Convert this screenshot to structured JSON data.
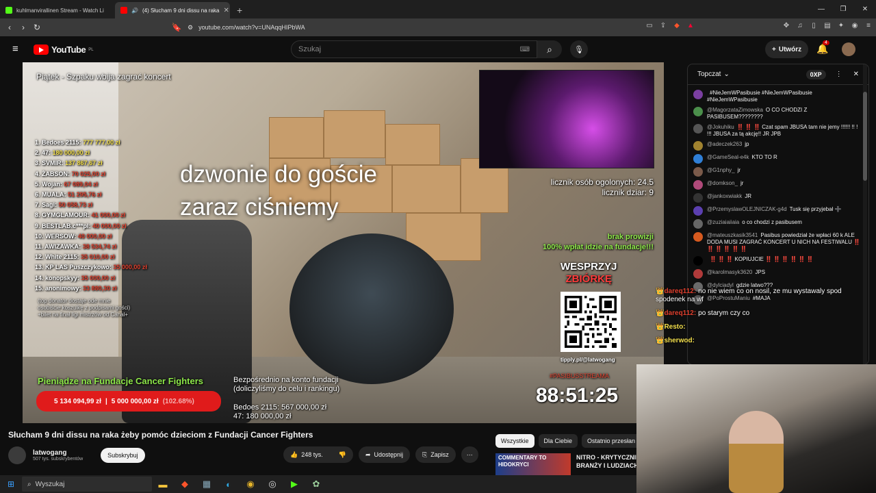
{
  "browser": {
    "tabs": [
      {
        "title": "kuhlmanvirallinen Stream - Watch Li",
        "color": "#53fc18"
      },
      {
        "title": "(4) Słucham 9 dni dissu na raka",
        "color": "#ff0000"
      }
    ],
    "url": "youtube.com/watch?v=UNAqqHIPbWA"
  },
  "yt": {
    "logo_text": "YouTube",
    "logo_country": "PL",
    "search_placeholder": "Szukaj",
    "create_label": "Utwórz",
    "notif_count": "4"
  },
  "stream": {
    "overlay_title": "Piątek - Szpaku wbija zagrać koncert",
    "big_text_line1": "dzwonie do goście",
    "big_text_line2": "zaraz ciśniemy",
    "leaderboard": [
      {
        "name": "1. Bedoes 2115:",
        "amount": "777 777,00 zł"
      },
      {
        "name": "2. 47:",
        "amount": "180 000,00 zł"
      },
      {
        "name": "3. SVMIR:",
        "amount": "137 867,67 zł"
      },
      {
        "name": "4. ŻABSON:",
        "amount": "70 025,00 zł"
      },
      {
        "name": "5. Wojan:",
        "amount": "67 089,04 zł"
      },
      {
        "name": "6. MUALA:",
        "amount": "51 295,76 zł"
      },
      {
        "name": "7. Sagi:",
        "amount": "50 058,73 zł"
      },
      {
        "name": "8. GYMGLAMOUR:",
        "amount": "41 000,00 zł"
      },
      {
        "name": "9. BESTLAB.c***pl:",
        "amount": "40 000,00 zł"
      },
      {
        "name": "10. WERSOW:",
        "amount": "40 000,00 zł"
      },
      {
        "name": "11. AWIZAWKA:",
        "amount": "38 534,74 zł"
      },
      {
        "name": "12. White 2115:",
        "amount": "35 010,00 zł"
      },
      {
        "name": "13. KP LAS Puszczykowo:",
        "amount": "35 000,00 zł"
      },
      {
        "name": "14. konopskyy:",
        "amount": "35 000,00 zł"
      },
      {
        "name": "15. anonimowy:",
        "amount": "33 880,30 zł"
      }
    ],
    "note_lines": [
      "(top donator dostaje ode mnie",
      "osobiście koszulkę z podpisami gości)",
      "+bilet na finał ligi mistrzów od Canal+"
    ],
    "counter_line1": "licznik osób ogolonych: 24.5",
    "counter_line2": "licznik dziar: 9",
    "green_line1": "brak prowizji",
    "green_line2": "100% wpłat idzie na fundacje!!!",
    "support_line1": "WESPRZYJ",
    "support_line2": "ZBIÓRKĘ",
    "tipply": "tipply.pl/@latwogang",
    "fund_label": "Pieniądze na Fundacje Cancer Fighters",
    "fund_raised": "5 134 094,99 zł",
    "fund_goal": "5 000 000,00 zł",
    "fund_pct": "(102.68%)",
    "fund_pct_value": 102.68,
    "direct_line1": "Bezpośrednio na konto fundacji",
    "direct_line2": "(doliczyliśmy do celu i rankingu)",
    "bedoes_line1": "Bedoes 2115: 567 000,00 zł",
    "bedoes_line2": "47: 180 000,00 zł",
    "timer": "88:51:25",
    "pasibus_row": "#PASIBUSSTREAMA"
  },
  "video": {
    "title": "Słucham 9 dni dissu na raka żeby pomóc dzieciom z Fundacji Cancer Fighters",
    "channel": "latwogang",
    "subs": "507 tys. subskrybentów",
    "subscribe": "Subskrybuj",
    "likes": "248 tys.",
    "share": "Udostępnij",
    "save": "Zapisz"
  },
  "chips": [
    "Wszystkie",
    "Dla Ciebie",
    "Ostatnio przesłan"
  ],
  "reco": {
    "thumb_text": "COMMENTARY TO HIDOKRYCI",
    "title": "NITRO - KRYTYCZNIE BRANŻY I LUDZIACH"
  },
  "chat": {
    "header": "Topczat",
    "xp": "0XP",
    "messages": [
      {
        "user": "",
        "text": "#NieJemWPasibusie #NieJemWPasibusie #NieJemWPasibusie",
        "color": "#7a3fa0"
      },
      {
        "user": "@MagorzataZimowska",
        "text": "O CO CHODZI Z PASIBUSEM????????",
        "color": "#4b8f4b"
      },
      {
        "user": "@Jokuhiku",
        "text": "‼️ ‼️ ‼️ Czat spam JBUSA tam nie jemy !!!!!! !! ! !!! JBUSA za tą akcję!! JR JPB",
        "color": "#555"
      },
      {
        "user": "@adeczek263",
        "text": "jp",
        "color": "#a0822f"
      },
      {
        "user": "@GameSeal-e4k",
        "text": "KTO TO R",
        "color": "#2f7fd6"
      },
      {
        "user": "@G1nphy_",
        "text": "jr",
        "color": "#7a5a4a"
      },
      {
        "user": "@domkson_",
        "text": "jr",
        "color": "#b04a7a"
      },
      {
        "user": "@jankoxwiakk",
        "text": "JR",
        "color": "#333"
      },
      {
        "user": "@PrzemyslawOLEJNICZAK-g4d",
        "text": "Tusk się przyjebał ➕",
        "color": "#5b3fb0"
      },
      {
        "user": "@zuziaiaiiaia",
        "text": "o co chodzi z pasibusem",
        "color": "#666"
      },
      {
        "user": "@mateuszkasik3541",
        "text": "Pasibus powiedział że wpłaci 60 k ALE DODA MUSI ZAGRAĆ KONCERT U NICH NA FESTIWALU ‼️ ‼️ ‼️ ‼️ ‼️ ‼️",
        "color": "#d65a1f"
      },
      {
        "user": "",
        "text": "‼️ ‼️ ‼️ KOPIUJCIE ‼️ ‼️ ‼️ ‼️ ‼️ ‼️",
        "color": "#000"
      },
      {
        "user": "@karolmasyk3620",
        "text": "JPS",
        "color": "#b03a3a"
      },
      {
        "user": "@dylciadyl",
        "text": "gdzie latwo???",
        "color": "#6a6a6a"
      },
      {
        "user": "@PoProstuManiu",
        "text": "#MAJA",
        "color": "#555"
      }
    ]
  },
  "overlay_chat": [
    {
      "name": "dareq112:",
      "text": "no nie wiem co on nosil, ze mu wystawaly spod spodenek na wf",
      "name_color": "#e0402e"
    },
    {
      "name": "dareq112:",
      "text": "po starym czy co",
      "name_color": "#e0402e"
    },
    {
      "name": "Resto:",
      "text": "",
      "name_color": "#f4e04d"
    },
    {
      "name": "sherwod:",
      "text": "",
      "name_color": "#f4e04d"
    }
  ],
  "taskbar": {
    "search": "Wyszukaj"
  }
}
